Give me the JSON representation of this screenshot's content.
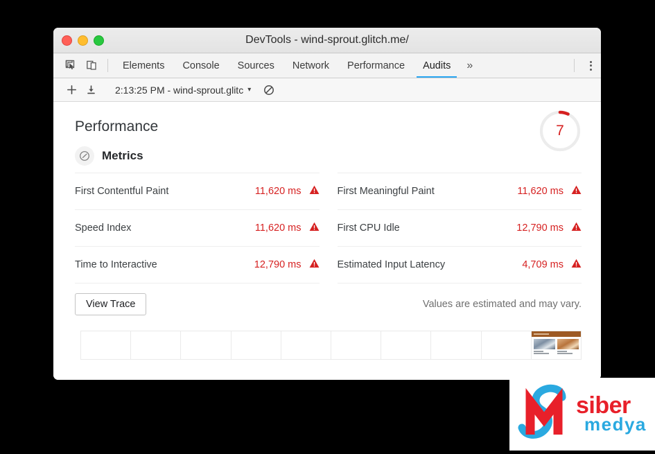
{
  "window": {
    "title": "DevTools - wind-sprout.glitch.me/",
    "traffic_lights": [
      "close",
      "minimize",
      "maximize"
    ]
  },
  "tabbar": {
    "icons": [
      {
        "name": "inspect-element-icon",
        "label": "Inspect element"
      },
      {
        "name": "device-toolbar-icon",
        "label": "Toggle device toolbar"
      }
    ],
    "tabs": [
      {
        "label": "Elements",
        "active": false
      },
      {
        "label": "Console",
        "active": false
      },
      {
        "label": "Sources",
        "active": false
      },
      {
        "label": "Network",
        "active": false
      },
      {
        "label": "Performance",
        "active": false
      },
      {
        "label": "Audits",
        "active": true
      }
    ],
    "more_label": "»",
    "menu_label": "Customize and control DevTools"
  },
  "subbar": {
    "new_audit_label": "+",
    "import_label": "Import",
    "report_selected": "2:13:25 PM - wind-sprout.glitc",
    "caret": "▾",
    "clear_label": "Clear all"
  },
  "report": {
    "category_title": "Performance",
    "score": "7",
    "score_color": "#d62121",
    "score_arc_percent": 7,
    "metrics_section_label": "Metrics",
    "metrics_icon": "gauge-icon",
    "metrics": {
      "left": [
        {
          "name": "First Contentful Paint",
          "value": "11,620 ms",
          "status": "fail"
        },
        {
          "name": "Speed Index",
          "value": "11,620 ms",
          "status": "fail"
        },
        {
          "name": "Time to Interactive",
          "value": "12,790 ms",
          "status": "fail"
        }
      ],
      "right": [
        {
          "name": "First Meaningful Paint",
          "value": "11,620 ms",
          "status": "fail"
        },
        {
          "name": "First CPU Idle",
          "value": "12,790 ms",
          "status": "fail"
        },
        {
          "name": "Estimated Input Latency",
          "value": "4,709 ms",
          "status": "fail"
        }
      ]
    },
    "view_trace_label": "View Trace",
    "disclaimer": "Values are estimated and may vary.",
    "filmstrip": {
      "frame_count": 10,
      "loaded_frame_index": 9
    }
  },
  "watermark": {
    "word_one": "siber",
    "word_two": "medya",
    "color_one": "#e8202a",
    "color_two": "#2aa9e0"
  }
}
